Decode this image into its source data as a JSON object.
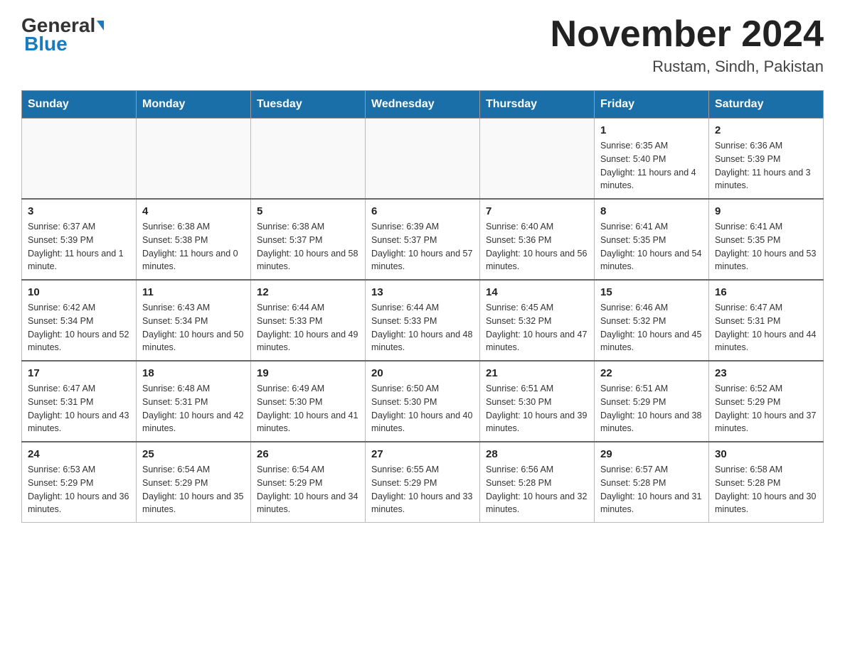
{
  "header": {
    "logo_general": "General",
    "logo_blue": "Blue",
    "month_year": "November 2024",
    "location": "Rustam, Sindh, Pakistan"
  },
  "days_of_week": [
    "Sunday",
    "Monday",
    "Tuesday",
    "Wednesday",
    "Thursday",
    "Friday",
    "Saturday"
  ],
  "weeks": [
    [
      {
        "day": "",
        "info": ""
      },
      {
        "day": "",
        "info": ""
      },
      {
        "day": "",
        "info": ""
      },
      {
        "day": "",
        "info": ""
      },
      {
        "day": "",
        "info": ""
      },
      {
        "day": "1",
        "info": "Sunrise: 6:35 AM\nSunset: 5:40 PM\nDaylight: 11 hours and 4 minutes."
      },
      {
        "day": "2",
        "info": "Sunrise: 6:36 AM\nSunset: 5:39 PM\nDaylight: 11 hours and 3 minutes."
      }
    ],
    [
      {
        "day": "3",
        "info": "Sunrise: 6:37 AM\nSunset: 5:39 PM\nDaylight: 11 hours and 1 minute."
      },
      {
        "day": "4",
        "info": "Sunrise: 6:38 AM\nSunset: 5:38 PM\nDaylight: 11 hours and 0 minutes."
      },
      {
        "day": "5",
        "info": "Sunrise: 6:38 AM\nSunset: 5:37 PM\nDaylight: 10 hours and 58 minutes."
      },
      {
        "day": "6",
        "info": "Sunrise: 6:39 AM\nSunset: 5:37 PM\nDaylight: 10 hours and 57 minutes."
      },
      {
        "day": "7",
        "info": "Sunrise: 6:40 AM\nSunset: 5:36 PM\nDaylight: 10 hours and 56 minutes."
      },
      {
        "day": "8",
        "info": "Sunrise: 6:41 AM\nSunset: 5:35 PM\nDaylight: 10 hours and 54 minutes."
      },
      {
        "day": "9",
        "info": "Sunrise: 6:41 AM\nSunset: 5:35 PM\nDaylight: 10 hours and 53 minutes."
      }
    ],
    [
      {
        "day": "10",
        "info": "Sunrise: 6:42 AM\nSunset: 5:34 PM\nDaylight: 10 hours and 52 minutes."
      },
      {
        "day": "11",
        "info": "Sunrise: 6:43 AM\nSunset: 5:34 PM\nDaylight: 10 hours and 50 minutes."
      },
      {
        "day": "12",
        "info": "Sunrise: 6:44 AM\nSunset: 5:33 PM\nDaylight: 10 hours and 49 minutes."
      },
      {
        "day": "13",
        "info": "Sunrise: 6:44 AM\nSunset: 5:33 PM\nDaylight: 10 hours and 48 minutes."
      },
      {
        "day": "14",
        "info": "Sunrise: 6:45 AM\nSunset: 5:32 PM\nDaylight: 10 hours and 47 minutes."
      },
      {
        "day": "15",
        "info": "Sunrise: 6:46 AM\nSunset: 5:32 PM\nDaylight: 10 hours and 45 minutes."
      },
      {
        "day": "16",
        "info": "Sunrise: 6:47 AM\nSunset: 5:31 PM\nDaylight: 10 hours and 44 minutes."
      }
    ],
    [
      {
        "day": "17",
        "info": "Sunrise: 6:47 AM\nSunset: 5:31 PM\nDaylight: 10 hours and 43 minutes."
      },
      {
        "day": "18",
        "info": "Sunrise: 6:48 AM\nSunset: 5:31 PM\nDaylight: 10 hours and 42 minutes."
      },
      {
        "day": "19",
        "info": "Sunrise: 6:49 AM\nSunset: 5:30 PM\nDaylight: 10 hours and 41 minutes."
      },
      {
        "day": "20",
        "info": "Sunrise: 6:50 AM\nSunset: 5:30 PM\nDaylight: 10 hours and 40 minutes."
      },
      {
        "day": "21",
        "info": "Sunrise: 6:51 AM\nSunset: 5:30 PM\nDaylight: 10 hours and 39 minutes."
      },
      {
        "day": "22",
        "info": "Sunrise: 6:51 AM\nSunset: 5:29 PM\nDaylight: 10 hours and 38 minutes."
      },
      {
        "day": "23",
        "info": "Sunrise: 6:52 AM\nSunset: 5:29 PM\nDaylight: 10 hours and 37 minutes."
      }
    ],
    [
      {
        "day": "24",
        "info": "Sunrise: 6:53 AM\nSunset: 5:29 PM\nDaylight: 10 hours and 36 minutes."
      },
      {
        "day": "25",
        "info": "Sunrise: 6:54 AM\nSunset: 5:29 PM\nDaylight: 10 hours and 35 minutes."
      },
      {
        "day": "26",
        "info": "Sunrise: 6:54 AM\nSunset: 5:29 PM\nDaylight: 10 hours and 34 minutes."
      },
      {
        "day": "27",
        "info": "Sunrise: 6:55 AM\nSunset: 5:29 PM\nDaylight: 10 hours and 33 minutes."
      },
      {
        "day": "28",
        "info": "Sunrise: 6:56 AM\nSunset: 5:28 PM\nDaylight: 10 hours and 32 minutes."
      },
      {
        "day": "29",
        "info": "Sunrise: 6:57 AM\nSunset: 5:28 PM\nDaylight: 10 hours and 31 minutes."
      },
      {
        "day": "30",
        "info": "Sunrise: 6:58 AM\nSunset: 5:28 PM\nDaylight: 10 hours and 30 minutes."
      }
    ]
  ]
}
